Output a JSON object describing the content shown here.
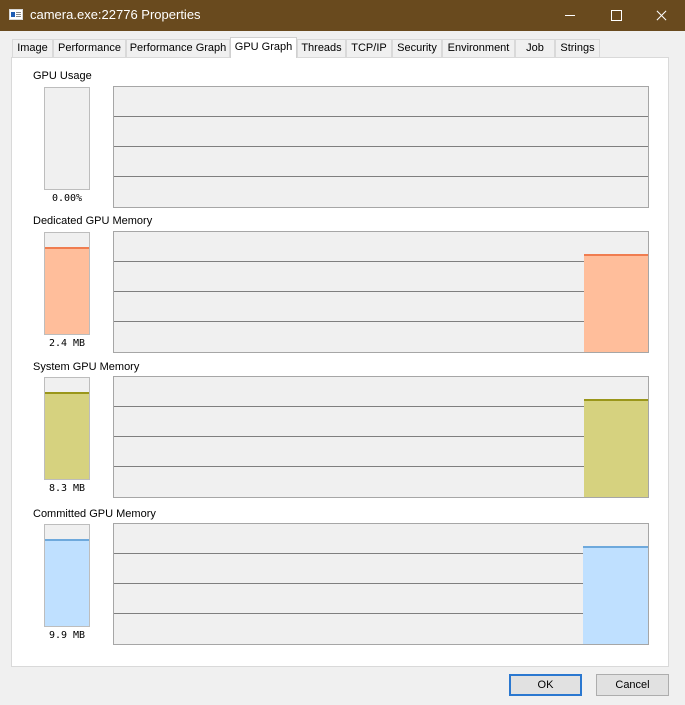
{
  "window": {
    "title": "camera.exe:22776 Properties"
  },
  "tabs": [
    {
      "label": "Image"
    },
    {
      "label": "Performance"
    },
    {
      "label": "Performance Graph"
    },
    {
      "label": "GPU Graph"
    },
    {
      "label": "Threads"
    },
    {
      "label": "TCP/IP"
    },
    {
      "label": "Security"
    },
    {
      "label": "Environment"
    },
    {
      "label": "Job"
    },
    {
      "label": "Strings"
    }
  ],
  "active_tab": "GPU Graph",
  "sections": [
    {
      "label": "GPU Usage",
      "value": "0.00%",
      "level": 0,
      "color": "#f0f0f0",
      "line_color": "#f0f0f0",
      "history_level": 0
    },
    {
      "label": "Dedicated GPU Memory",
      "value": "2.4 MB",
      "level": 0.84,
      "color": "#ffbe9b",
      "line_color": "#f07d50",
      "history_level": 0.82
    },
    {
      "label": "System GPU Memory",
      "value": "8.3 MB",
      "level": 0.84,
      "color": "#d6d27f",
      "line_color": "#9a961a",
      "history_level": 0.82
    },
    {
      "label": "Committed GPU Memory",
      "value": "9.9 MB",
      "level": 0.84,
      "color": "#bfe0ff",
      "line_color": "#6ea9dc",
      "history_level": 0.82
    }
  ],
  "buttons": {
    "ok": "OK",
    "cancel": "Cancel"
  }
}
